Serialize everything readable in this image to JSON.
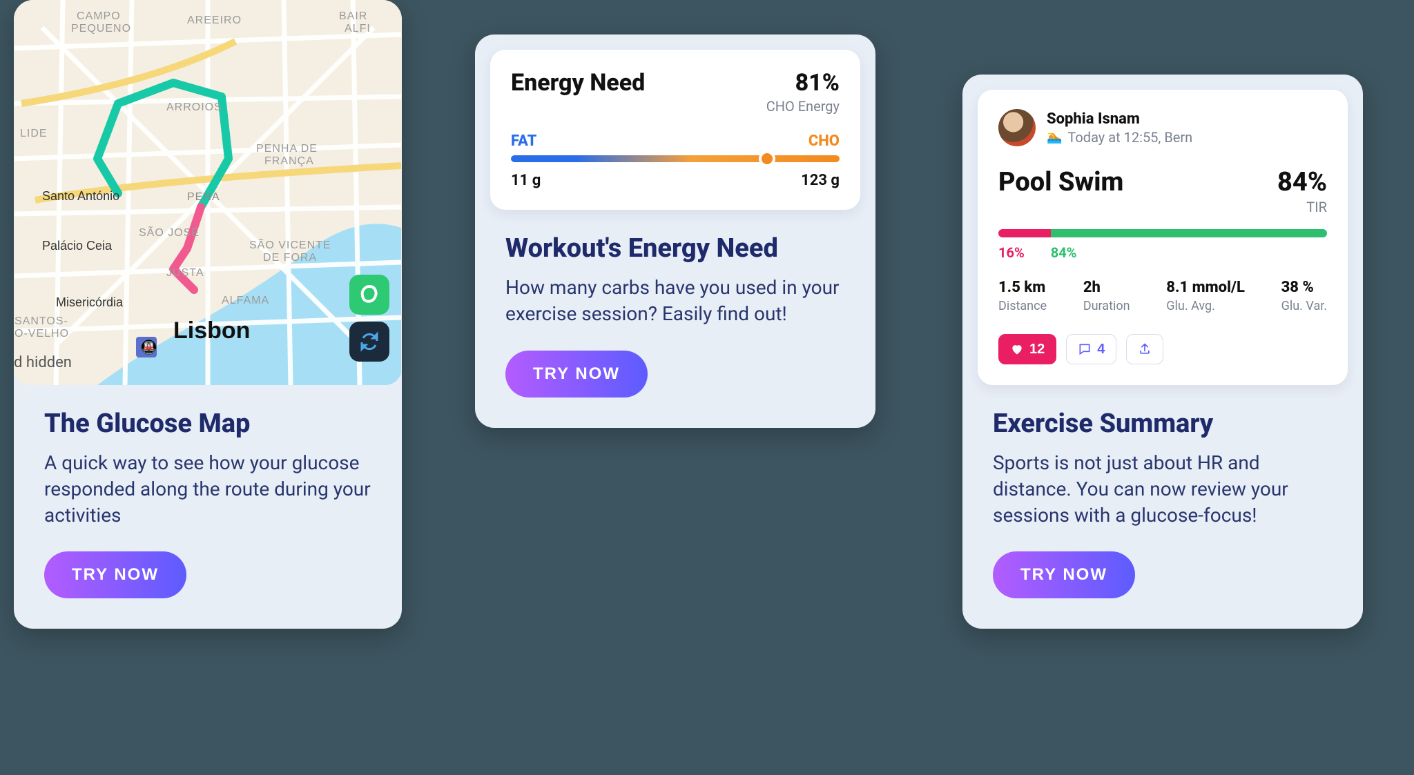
{
  "cta_label": "TRY NOW",
  "card1": {
    "title": "The Glucose Map",
    "desc": "A quick way to see how your glucose responded along the route during your activities",
    "map": {
      "city_label": "Lisbon",
      "hidden_label": "d hidden",
      "areas": [
        "CAMPO PEQUENO",
        "AREEIRO",
        "BAIR ALFI",
        "LIDE",
        "ARROIOS",
        "PENHA DE FRANÇA",
        "Santo António",
        "PENA",
        "SÃO JOSÉ",
        "Palácio Ceia",
        "SÃO VICENTE DE FORA",
        "JUSTA",
        "Misericórdia",
        "ALFAMA",
        "SANTOS-O-VELHO"
      ],
      "route_colors": [
        "#18c9a7",
        "#f15a8f"
      ]
    }
  },
  "card2": {
    "panel": {
      "title": "Energy Need",
      "percent": "81%",
      "sub": "CHO Energy",
      "left_label": "FAT",
      "right_label": "CHO",
      "left_value": "11 g",
      "right_value": "123 g",
      "knob_position_pct": 78
    },
    "title": "Workout's Energy Need",
    "desc": "How many carbs have you used in your exercise session? Easily find out!"
  },
  "card3": {
    "user": {
      "name": "Sophia Isnam",
      "subtitle": "Today at 12:55, Bern"
    },
    "panel": {
      "title": "Pool Swim",
      "percent": "84%",
      "sub": "TIR",
      "pink_pct": 16,
      "green_pct": 84,
      "pink_label": "16%",
      "green_label": "84%",
      "stats": [
        {
          "value": "1.5 km",
          "label": "Distance"
        },
        {
          "value": "2h",
          "label": "Duration"
        },
        {
          "value": "8.1 mmol/L",
          "label": "Glu. Avg."
        },
        {
          "value": "38 %",
          "label": "Glu. Var."
        }
      ],
      "likes": "12",
      "comments": "4"
    },
    "title": "Exercise Summary",
    "desc": "Sports is not just about HR and distance. You can now review your sessions with a glucose-focus!"
  }
}
